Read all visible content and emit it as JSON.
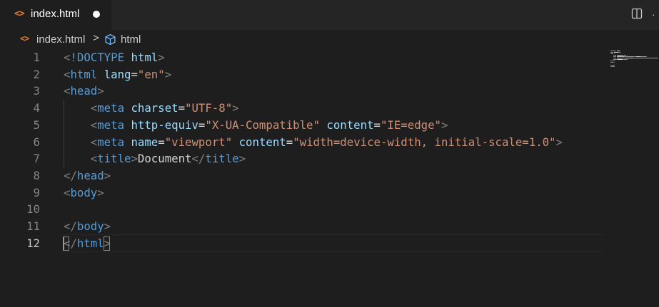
{
  "tab": {
    "title": "index.html",
    "file_icon": "<>"
  },
  "breadcrumb": {
    "file_icon": "<>",
    "file": "index.html",
    "separator": ">",
    "symbol": "html"
  },
  "colors": {
    "background": "#1e1e1e",
    "tag": "#569cd6",
    "attribute": "#9cdcfe",
    "string": "#ce9178",
    "punctuation": "#808080",
    "text": "#d4d4d4",
    "html_icon": "#e37933"
  },
  "editor": {
    "active_line": 12,
    "lines": [
      {
        "n": "1",
        "tokens": [
          [
            "punc",
            "<"
          ],
          [
            "tag",
            "!DOCTYPE"
          ],
          [
            "text",
            " "
          ],
          [
            "attr",
            "html"
          ],
          [
            "punc",
            ">"
          ]
        ]
      },
      {
        "n": "2",
        "tokens": [
          [
            "punc",
            "<"
          ],
          [
            "tag",
            "html"
          ],
          [
            "text",
            " "
          ],
          [
            "attr",
            "lang"
          ],
          [
            "text",
            "="
          ],
          [
            "str",
            "\"en\""
          ],
          [
            "punc",
            ">"
          ]
        ]
      },
      {
        "n": "3",
        "tokens": [
          [
            "punc",
            "<"
          ],
          [
            "tag",
            "head"
          ],
          [
            "punc",
            ">"
          ]
        ]
      },
      {
        "n": "4",
        "tokens": [
          [
            "text",
            "    "
          ],
          [
            "punc",
            "<"
          ],
          [
            "tag",
            "meta"
          ],
          [
            "text",
            " "
          ],
          [
            "attr",
            "charset"
          ],
          [
            "text",
            "="
          ],
          [
            "str",
            "\"UTF-8\""
          ],
          [
            "punc",
            ">"
          ]
        ]
      },
      {
        "n": "5",
        "tokens": [
          [
            "text",
            "    "
          ],
          [
            "punc",
            "<"
          ],
          [
            "tag",
            "meta"
          ],
          [
            "text",
            " "
          ],
          [
            "attr",
            "http-equiv"
          ],
          [
            "text",
            "="
          ],
          [
            "str",
            "\"X-UA-Compatible\""
          ],
          [
            "text",
            " "
          ],
          [
            "attr",
            "content"
          ],
          [
            "text",
            "="
          ],
          [
            "str",
            "\"IE=edge\""
          ],
          [
            "punc",
            ">"
          ]
        ]
      },
      {
        "n": "6",
        "tokens": [
          [
            "text",
            "    "
          ],
          [
            "punc",
            "<"
          ],
          [
            "tag",
            "meta"
          ],
          [
            "text",
            " "
          ],
          [
            "attr",
            "name"
          ],
          [
            "text",
            "="
          ],
          [
            "str",
            "\"viewport\""
          ],
          [
            "text",
            " "
          ],
          [
            "attr",
            "content"
          ],
          [
            "text",
            "="
          ],
          [
            "str",
            "\"width=device-width, initial-scale=1.0\""
          ],
          [
            "punc",
            ">"
          ]
        ]
      },
      {
        "n": "7",
        "tokens": [
          [
            "text",
            "    "
          ],
          [
            "punc",
            "<"
          ],
          [
            "tag",
            "title"
          ],
          [
            "punc",
            ">"
          ],
          [
            "text",
            "Document"
          ],
          [
            "punc",
            "</"
          ],
          [
            "tag",
            "title"
          ],
          [
            "punc",
            ">"
          ]
        ]
      },
      {
        "n": "8",
        "tokens": [
          [
            "punc",
            "</"
          ],
          [
            "tag",
            "head"
          ],
          [
            "punc",
            ">"
          ]
        ]
      },
      {
        "n": "9",
        "tokens": [
          [
            "punc",
            "<"
          ],
          [
            "tag",
            "body"
          ],
          [
            "punc",
            ">"
          ]
        ]
      },
      {
        "n": "10",
        "tokens": []
      },
      {
        "n": "11",
        "tokens": [
          [
            "punc",
            "</"
          ],
          [
            "tag",
            "body"
          ],
          [
            "punc",
            ">"
          ]
        ]
      },
      {
        "n": "12",
        "tokens": [
          [
            "punc",
            "</"
          ],
          [
            "tag",
            "html"
          ],
          [
            "punc",
            ">"
          ]
        ]
      }
    ]
  }
}
